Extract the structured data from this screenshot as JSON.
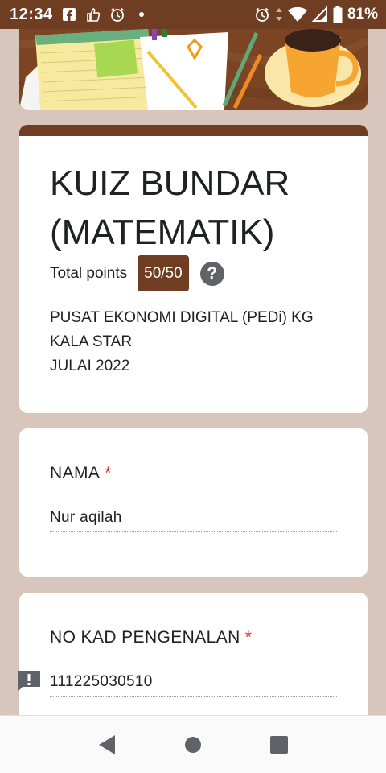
{
  "status_bar": {
    "time": "12:34",
    "battery_text": "81%",
    "icons_left": [
      "facebook-icon",
      "thumbs-up-icon",
      "alarm-icon",
      "dot-icon"
    ],
    "icons_right": [
      "alarm-icon",
      "data-arrows-icon",
      "wifi-icon",
      "signal-icon",
      "battery-icon"
    ]
  },
  "form": {
    "title": "KUIZ BUNDAR (MATEMATIK)",
    "points_label": "Total points",
    "points_value": "50/50",
    "description": [
      "PUSAT EKONOMI DIGITAL (PEDi) KG",
      "KALA STAR",
      "JULAI 2022"
    ]
  },
  "questions": [
    {
      "title": "NAMA",
      "required_mark": "*",
      "answer": "Nur aqilah"
    },
    {
      "title": "NO KAD PENGENALAN",
      "required_mark": "*",
      "answer": "111225030510"
    }
  ],
  "colors": {
    "theme": "#6f3e22",
    "background": "#d8c6bd",
    "required": "#d93025"
  },
  "nav": [
    "back-icon",
    "home-icon",
    "recents-icon"
  ]
}
